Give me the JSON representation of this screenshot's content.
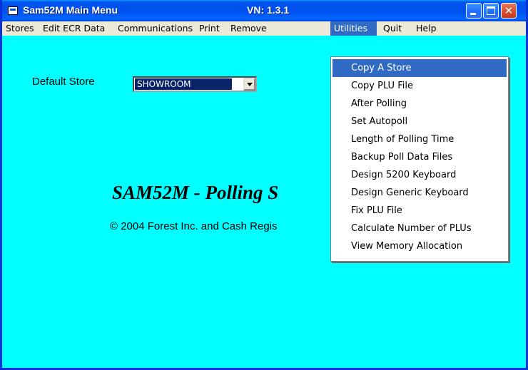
{
  "window": {
    "title": "Sam52M Main Menu",
    "version": "VN: 1.3.1",
    "close_glyph": "✕"
  },
  "menubar": {
    "items": [
      "Stores",
      "Edit ECR Data",
      "Communications",
      "Print",
      "Remove",
      "Utilities",
      "Quit",
      "Help"
    ],
    "active": "Utilities"
  },
  "main": {
    "default_store_label": "Default Store",
    "default_store_value": "SHOWROOM",
    "headline": "SAM52M - Polling S",
    "copyright": "© 2004 Forest Inc. and Cash Regis"
  },
  "utilities_menu": {
    "items": [
      "Copy A Store",
      "Copy PLU File",
      "After Polling",
      "Set Autopoll",
      "Length of Polling Time",
      "Backup Poll Data Files",
      "Design 5200 Keyboard",
      "Design Generic Keyboard",
      "Fix PLU File",
      "Calculate Number of PLUs",
      "View Memory Allocation"
    ],
    "highlighted": "Copy A Store"
  },
  "colors": {
    "background": "#00ffff",
    "titlebar": "#0053ee",
    "menu_highlight": "#316ac5",
    "menubar": "#ece9d8"
  },
  "icons": [
    "app-icon",
    "minimize-icon",
    "maximize-icon",
    "close-icon",
    "dropdown-arrow-icon"
  ]
}
